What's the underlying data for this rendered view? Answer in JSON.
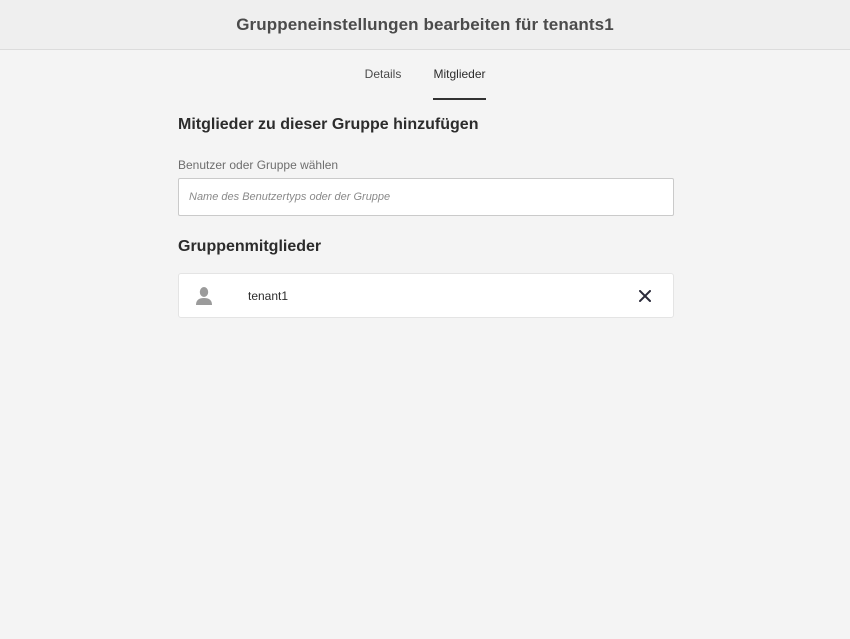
{
  "header": {
    "title": "Gruppeneinstellungen bearbeiten für tenants1"
  },
  "tabs": [
    {
      "label": "Details",
      "active": false
    },
    {
      "label": "Mitglieder",
      "active": true
    }
  ],
  "add_section": {
    "title": "Mitglieder zu dieser Gruppe hinzufügen",
    "field_label": "Benutzer oder Gruppe wählen",
    "input_value": "",
    "input_placeholder": "Name des Benutzertyps oder der Gruppe"
  },
  "members_section": {
    "title": "Gruppenmitglieder",
    "members": [
      {
        "name": "tenant1",
        "icon": "user-icon",
        "action_icon": "close-icon"
      }
    ]
  },
  "colors": {
    "background": "#f4f4f4",
    "header_background": "#efefef",
    "active_tab_underline": "#323232",
    "avatar": "#9b9b9b",
    "remove_icon": "#2b2b3a"
  }
}
